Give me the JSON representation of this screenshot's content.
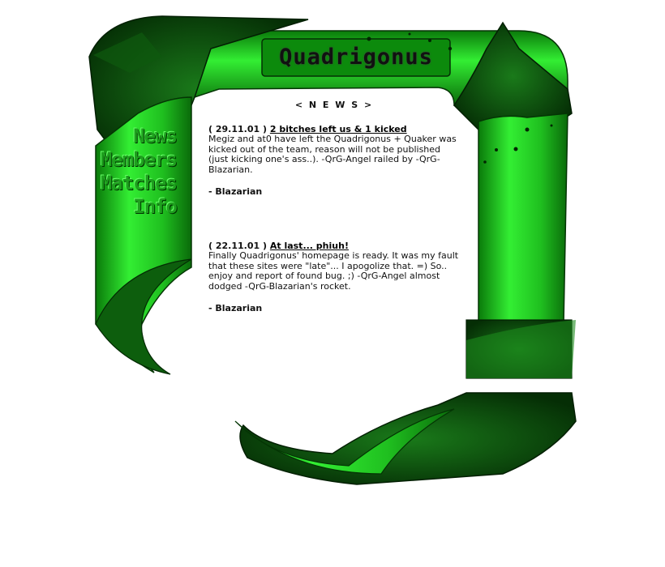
{
  "site": {
    "logo_text": "Quadrigonus"
  },
  "nav": {
    "items": [
      {
        "label": "News"
      },
      {
        "label": "Members"
      },
      {
        "label": "Matches"
      },
      {
        "label": "Info"
      }
    ]
  },
  "news": {
    "heading": "< N E W S >",
    "items": [
      {
        "date": "( 29.11.01 )",
        "title": "2 bitches left us & 1 kicked",
        "body": "Megiz and at0 have left the Quadrigonus + Quaker was kicked out of the team, reason will not be published (just kicking one's ass..). -QrG-Angel railed by -QrG-Blazarian.",
        "author": "- Blazarian"
      },
      {
        "date": "( 22.11.01 )",
        "title": "At last... phiuh!",
        "body": "Finally Quadrigonus' homepage is ready. It was my fault that these sites were \"late\"... I apogolize that. =) So.. enjoy and report of found bug. ;) -QrG-Angel almost dodged -QrG-Blazarian's rocket.",
        "author": "- Blazarian"
      }
    ]
  },
  "colors": {
    "primary_green": "#1fbf1f",
    "dark_green": "#0b4a0b",
    "bright_green": "#33ee33"
  }
}
